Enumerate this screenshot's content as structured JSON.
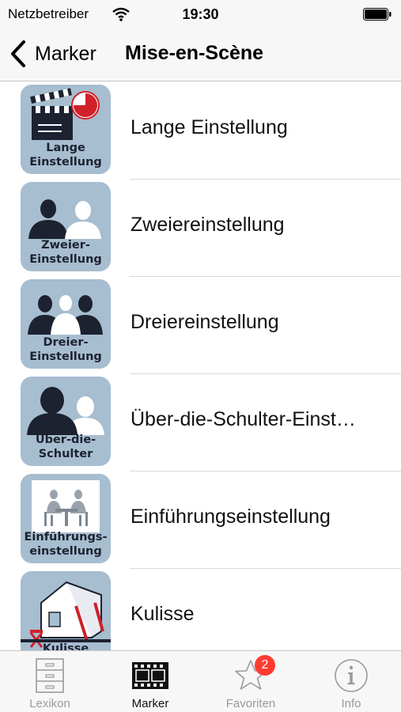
{
  "status_bar": {
    "carrier": "Netzbetreiber",
    "time": "19:30",
    "wifi_icon": "wifi-icon",
    "battery_icon": "battery-icon"
  },
  "nav_bar": {
    "back_label": "Marker",
    "back_icon": "chevron-left-icon",
    "title": "Mise-en-Scène"
  },
  "list": {
    "items": [
      {
        "label": "Lange Einstellung",
        "thumb_line1": "Lange",
        "thumb_line2": "Einstellung",
        "icon": "clapperboard-clock-icon"
      },
      {
        "label": "Zweiereinstellung",
        "thumb_line1": "Zweier-",
        "thumb_line2": "Einstellung",
        "icon": "two-people-icon"
      },
      {
        "label": "Dreiereinstellung",
        "thumb_line1": "Dreier-",
        "thumb_line2": "Einstellung",
        "icon": "three-people-icon"
      },
      {
        "label": "Über-die-Schulter-Einst…",
        "thumb_line1": "Über-die-",
        "thumb_line2": "Schulter",
        "icon": "over-shoulder-icon"
      },
      {
        "label": "Einführungseinstellung",
        "thumb_line1": "Einführungs-",
        "thumb_line2": "einstellung",
        "icon": "establishing-shot-icon"
      },
      {
        "label": "Kulisse",
        "thumb_line1": "Kulisse",
        "thumb_line2": "",
        "icon": "film-set-icon"
      }
    ]
  },
  "tab_bar": {
    "tabs": [
      {
        "label": "Lexikon",
        "icon": "cabinet-icon",
        "active": false
      },
      {
        "label": "Marker",
        "icon": "film-strip-icon",
        "active": true
      },
      {
        "label": "Favoriten",
        "icon": "star-icon",
        "active": false,
        "badge": "2"
      },
      {
        "label": "Info",
        "icon": "info-icon",
        "active": false
      }
    ]
  },
  "colors": {
    "thumb_bg": "#a7bdd0",
    "silhouette_dark": "#1c2230",
    "silhouette_light": "#ffffff",
    "badge_red": "#ff3b30",
    "clock_red": "#d0202a"
  }
}
